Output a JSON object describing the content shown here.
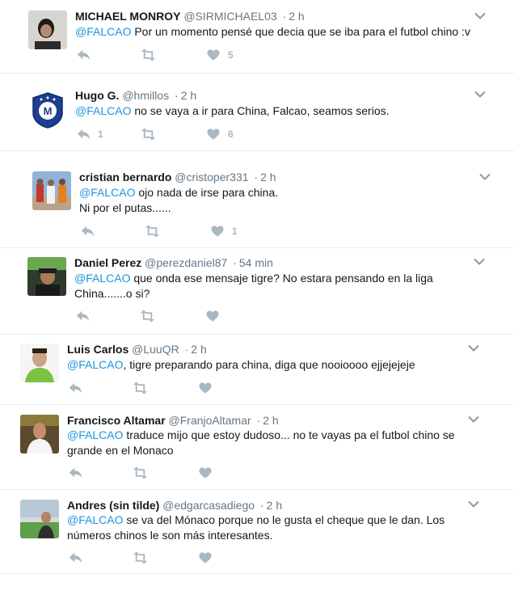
{
  "tweets": [
    {
      "fullname": "MICHAEL MONROY",
      "handle": "@SIRMICHAEL03",
      "time": "2 h",
      "mention": "@FALCAO",
      "text1": " Por un momento pensé que decia que se iba para el futbol chino :v",
      "text2": "",
      "replies": "",
      "retweets": "",
      "likes": "5"
    },
    {
      "fullname": "Hugo G.",
      "handle": "@hmillos",
      "time": "2 h",
      "mention": "@FALCAO",
      "text1": " no se vaya a ir para China, Falcao, seamos serios.",
      "text2": "",
      "replies": "1",
      "retweets": "",
      "likes": "6"
    },
    {
      "fullname": "cristian bernardo",
      "handle": "@cristoper331",
      "time": "2 h",
      "mention": "@FALCAO",
      "text1": " ojo nada de irse para china.",
      "text2": "Ni por el putas......",
      "replies": "",
      "retweets": "",
      "likes": "1"
    },
    {
      "fullname": "Daniel Perez",
      "handle": "@perezdaniel87",
      "time": "54 min",
      "mention": "@FALCAO",
      "text1": " que onda ese mensaje tigre? No estara pensando en la liga",
      "text2": "China.......o si?",
      "replies": "",
      "retweets": "",
      "likes": ""
    },
    {
      "fullname": "Luis Carlos",
      "handle": "@LuuQR",
      "time": "2 h",
      "mention": "@FALCAO",
      "text1": ", tigre preparando para china, diga que nooioooo ejjejejeje",
      "text2": "",
      "replies": "",
      "retweets": "",
      "likes": ""
    },
    {
      "fullname": "Francisco Altamar",
      "handle": "@FranjoAltamar",
      "time": "2 h",
      "mention": "@FALCAO",
      "text1": " traduce mijo que estoy dudoso... no te vayas pa el futbol chino se",
      "text2": "grande en el Monaco",
      "replies": "",
      "retweets": "",
      "likes": ""
    },
    {
      "fullname": "Andres (sin tilde)",
      "handle": "@edgarcasadiego",
      "time": "2 h",
      "mention": "@FALCAO",
      "text1": " se va del Mónaco porque no le gusta el cheque que le dan. Los",
      "text2": "números chinos le son más interesantes.",
      "replies": "",
      "retweets": "",
      "likes": ""
    }
  ],
  "ui": {
    "separator": "·",
    "icon_names": [
      "reply-icon",
      "retweet-icon",
      "like-icon",
      "chevron-down-icon"
    ],
    "colors": {
      "link": "#1b95e0",
      "muted": "#657786",
      "action": "#aab8c2",
      "border": "#e6ecf0"
    }
  }
}
